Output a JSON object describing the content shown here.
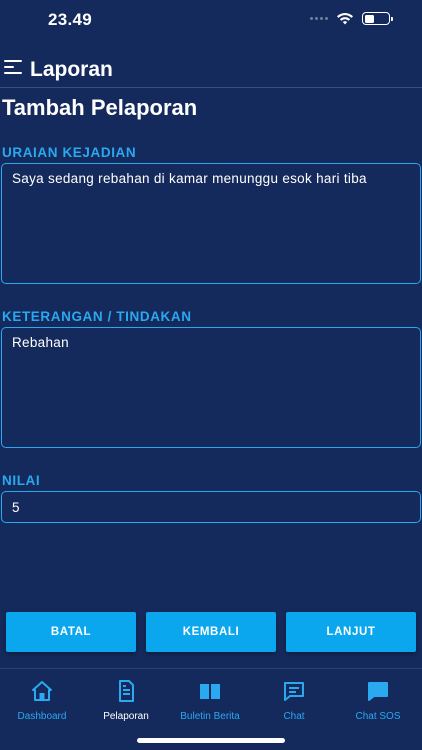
{
  "status_bar": {
    "time": "23.49"
  },
  "header": {
    "title": "Laporan"
  },
  "page": {
    "title": "Tambah Pelaporan"
  },
  "form": {
    "uraian_label": "URAIAN KEJADIAN",
    "uraian_value": "Saya sedang rebahan di kamar menunggu esok hari tiba",
    "keterangan_label": "KETERANGAN / TINDAKAN",
    "keterangan_value": "Rebahan",
    "nilai_label": "NILAI",
    "nilai_value": "5"
  },
  "actions": {
    "batal": "BATAL",
    "kembali": "KEMBALI",
    "lanjut": "LANJUT"
  },
  "nav": {
    "items": [
      {
        "label": "Dashboard",
        "icon": "home-icon",
        "active": false
      },
      {
        "label": "Pelaporan",
        "icon": "document-icon",
        "active": true
      },
      {
        "label": "Buletin Berita",
        "icon": "book-icon",
        "active": false
      },
      {
        "label": "Chat",
        "icon": "chat-icon",
        "active": false
      },
      {
        "label": "Chat SOS",
        "icon": "chat-bubble-icon",
        "active": false
      }
    ]
  },
  "colors": {
    "background": "#152a5c",
    "accent": "#2aa8f0",
    "button": "#0aa7ee",
    "text": "#ffffff"
  }
}
